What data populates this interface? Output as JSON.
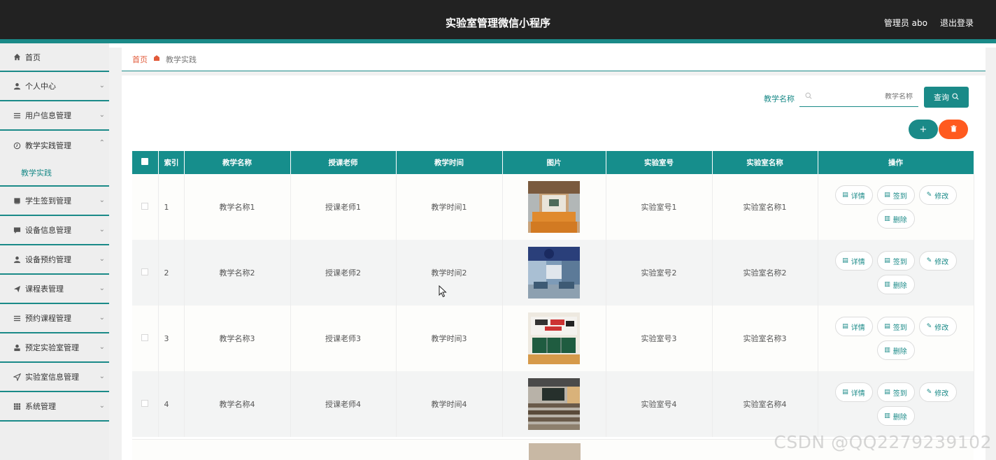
{
  "header": {
    "title": "实验室管理微信小程序",
    "user": "管理员 abo",
    "logout": "退出登录"
  },
  "sidebar": {
    "items": [
      {
        "label": "首页",
        "icon": "home-icon"
      },
      {
        "label": "个人中心",
        "icon": "person-icon"
      },
      {
        "label": "用户信息管理",
        "icon": "list-icon"
      },
      {
        "label": "教学实践管理",
        "icon": "clock-icon"
      },
      {
        "label": "学生签到管理",
        "icon": "book-icon"
      },
      {
        "label": "设备信息管理",
        "icon": "chat-icon"
      },
      {
        "label": "设备预约管理",
        "icon": "person-icon"
      },
      {
        "label": "课程表管理",
        "icon": "send-icon"
      },
      {
        "label": "预约课程管理",
        "icon": "list-icon"
      },
      {
        "label": "预定实验室管理",
        "icon": "person-icon"
      },
      {
        "label": "实验室信息管理",
        "icon": "navigate-icon"
      },
      {
        "label": "系统管理",
        "icon": "grid-icon"
      }
    ],
    "sub_item": "教学实践"
  },
  "breadcrumb": {
    "home": "首页",
    "current": "教学实践"
  },
  "search": {
    "label": "教学名称",
    "placeholder": "教学名称",
    "query_button": "查询"
  },
  "table": {
    "headers": [
      "索引",
      "教学名称",
      "授课老师",
      "教学时间",
      "图片",
      "实验室号",
      "实验室名称",
      "操作"
    ],
    "rows": [
      {
        "index": "1",
        "name": "教学名称1",
        "teacher": "授课老师1",
        "time": "教学时间1",
        "lab_no": "实验室号1",
        "lab_name": "实验室名称1"
      },
      {
        "index": "2",
        "name": "教学名称2",
        "teacher": "授课老师2",
        "time": "教学时间2",
        "lab_no": "实验室号2",
        "lab_name": "实验室名称2"
      },
      {
        "index": "3",
        "name": "教学名称3",
        "teacher": "授课老师3",
        "time": "教学时间3",
        "lab_no": "实验室号3",
        "lab_name": "实验室名称3"
      },
      {
        "index": "4",
        "name": "教学名称4",
        "teacher": "授课老师4",
        "time": "教学时间4",
        "lab_no": "实验室号4",
        "lab_name": "实验室名称4"
      }
    ],
    "actions": {
      "detail": "详情",
      "checkin": "签到",
      "edit": "修改",
      "delete": "删除"
    }
  },
  "watermark": "CSDN @QQ2279239102",
  "colors": {
    "accent": "#1a8a88",
    "danger": "#ff5a1f",
    "header_bg": "#222222"
  }
}
